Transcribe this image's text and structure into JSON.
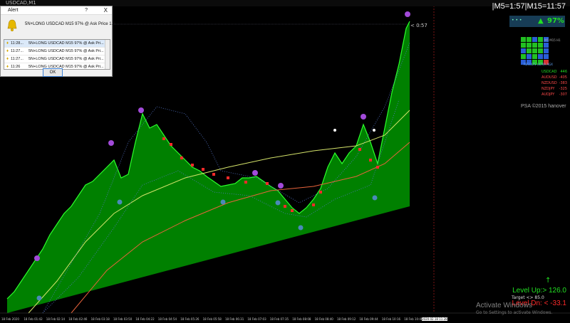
{
  "window": {
    "title": "USDCAD,M1"
  },
  "clock": "|M5=1:57|M15=11:57",
  "price_marker": "< 0:57",
  "alert": {
    "title": "Alert",
    "help_icon": "?",
    "close_icon": "X",
    "message": "5N+LONG  USDCAD M15 97% @ Ask Price  1.3",
    "rows": [
      {
        "time": "11:28...",
        "text": "5N+LONG  USDCAD M15 97% @ Ask Pri..."
      },
      {
        "time": "11:27...",
        "text": "5N+LONG  USDCAD M15 97% @ Ask Pri..."
      },
      {
        "time": "11:27...",
        "text": "5N+LONG  USDCAD M15 97% @ Ask Pri..."
      },
      {
        "time": "11:26",
        "text": "5N+LONG  USDCAD M15 97% @ Ask Pri..."
      }
    ],
    "ok_label": "OK"
  },
  "strength_widget": {
    "percent": "97%",
    "direction_icon": "up-arrow-icon"
  },
  "mini_header": "M5 M15 H1",
  "ultra_label": "RESULTS ULTRA AGX",
  "pairs": [
    {
      "pair": "USDCAD",
      "value": "446",
      "color": "#22e022"
    },
    {
      "pair": "AUDUSD",
      "value": "-405",
      "color": "#ff4a4a"
    },
    {
      "pair": "NZDUSD",
      "value": "-383",
      "color": "#ff4a4a"
    },
    {
      "pair": "NZDJPY",
      "value": "-325",
      "color": "#ff4a4a"
    },
    {
      "pair": "AUDJPY",
      "value": "-307",
      "color": "#ff4a4a"
    }
  ],
  "psa": "PSA ©2015 hanover",
  "level_up": {
    "label": "Level Up:>",
    "value": "126.0"
  },
  "target": "Target <> 85.0",
  "level_down": {
    "label": "Level Dn: <",
    "value": "-33.1"
  },
  "watermark": {
    "line1": "Activate Windows",
    "line2": "Go to Settings to activate Windows."
  },
  "x_labels": [
    "18 Feb 2020",
    "18 Feb 01:42",
    "18 Feb 02:14",
    "18 Feb 02:46",
    "18 Feb 03:18",
    "18 Feb 03:50",
    "18 Feb 04:22",
    "18 Feb 04:54",
    "18 Feb 05:26",
    "18 Feb 05:58",
    "18 Feb 06:31",
    "18 Feb 07:03",
    "18 Feb 07:35",
    "18 Feb 08:08",
    "18 Feb 08:40",
    "18 Feb 09:12",
    "18 Feb 09:44",
    "18 Feb 10:16",
    "18 Feb 10:48",
    "2020.02.18 11:28"
  ],
  "colors": {
    "accent_green": "#22e022",
    "area_green": "#008000",
    "bright_green": "#2bff2b",
    "sell_red": "#ff2a2a",
    "ma_yellow": "#d4e36a",
    "ma_orange": "#e8643c",
    "purple": "#a24ad9"
  }
}
